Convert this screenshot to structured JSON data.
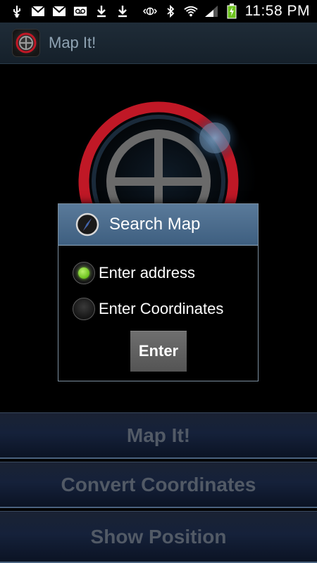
{
  "status_bar": {
    "time": "11:58 PM",
    "icons": [
      "usb-icon",
      "gmail-icon",
      "gmail-icon",
      "voicemail-icon",
      "download-icon",
      "download-icon",
      "nfc-icon",
      "bluetooth-icon",
      "wifi-icon",
      "signal-icon",
      "battery-charging-icon"
    ]
  },
  "action_bar": {
    "title": "Map It!"
  },
  "dialog": {
    "title": "Search Map",
    "options": [
      {
        "label": "Enter address",
        "selected": true
      },
      {
        "label": "Enter Coordinates",
        "selected": false
      }
    ],
    "enter_label": "Enter"
  },
  "buttons": {
    "map_it": "Map It!",
    "convert": "Convert Coordinates",
    "show_position": "Show Position"
  },
  "colors": {
    "accent": "#6cc21d",
    "dialog_header": "#4a6a8c",
    "button_text": "#525a66"
  }
}
